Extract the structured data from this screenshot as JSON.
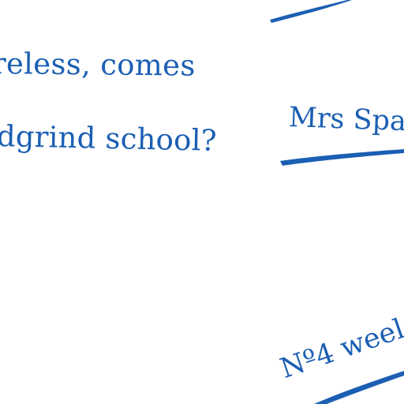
{
  "handwriting": {
    "line_1": "reless, comes",
    "line_2": "dgrind school?",
    "name_label": "Mrs Spa",
    "week_label": "Nº4 weel"
  },
  "colors": {
    "ink": "#1b5fb3",
    "paper": "#ffffff"
  }
}
